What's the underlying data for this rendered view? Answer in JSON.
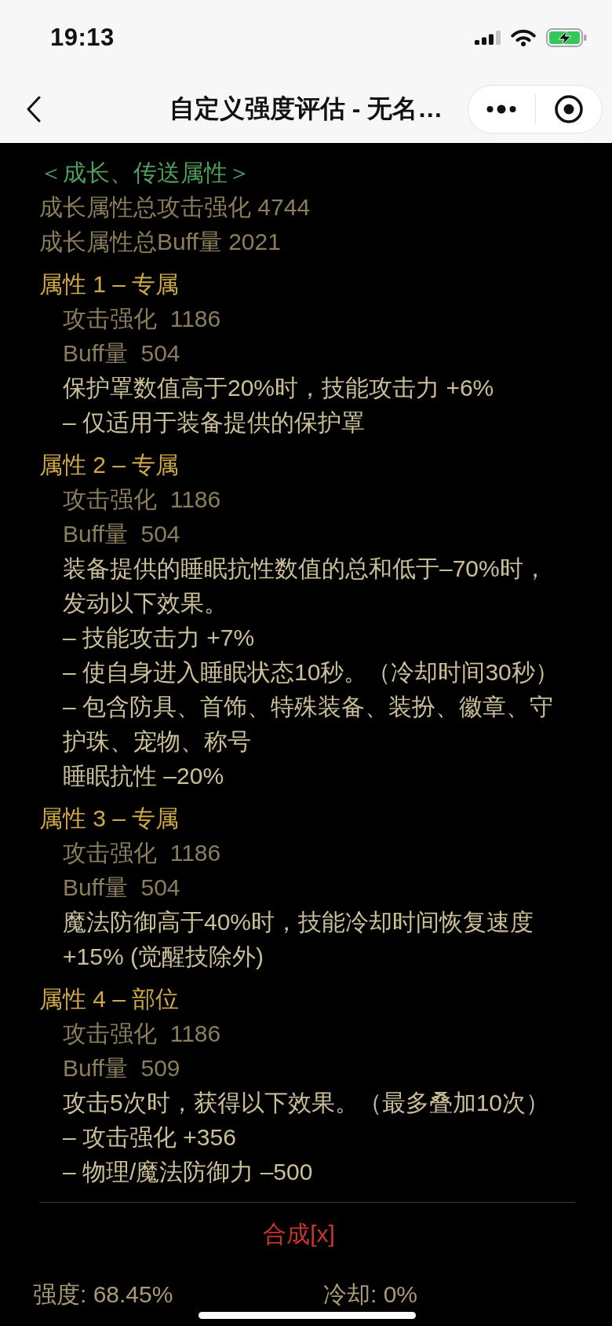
{
  "status_bar": {
    "time": "19:13"
  },
  "nav_bar": {
    "title": "自定义强度评估 - 无名…"
  },
  "growth": {
    "heading": "＜成长、传送属性＞",
    "totals": [
      "成长属性总攻击强化 4744",
      "成长属性总Buff量 2021"
    ]
  },
  "attributes": [
    {
      "title": "属性 1 – 专属",
      "stats": [
        "攻击强化  1186",
        "Buff量  504"
      ],
      "effects": [
        "保护罩数值高于20%时，技能攻击力 +6%",
        "– 仅适用于装备提供的保护罩"
      ]
    },
    {
      "title": "属性 2 – 专属",
      "stats": [
        "攻击强化  1186",
        "Buff量  504"
      ],
      "effects": [
        "装备提供的睡眠抗性数值的总和低于–70%时，发动以下效果。",
        "– 技能攻击力 +7%",
        "– 使自身进入睡眠状态10秒。（冷却时间30秒）",
        "– 包含防具、首饰、特殊装备、装扮、徽章、守护珠、宠物、称号",
        "睡眠抗性 –20%"
      ]
    },
    {
      "title": "属性 3 – 专属",
      "stats": [
        "攻击强化  1186",
        "Buff量  504"
      ],
      "effects": [
        "魔法防御高于40%时，技能冷却时间恢复速度 +15% (觉醒技除外)"
      ]
    },
    {
      "title": "属性 4 – 部位",
      "stats": [
        "攻击强化  1186",
        "Buff量  509"
      ],
      "effects": [
        "攻击5次时，获得以下效果。（最多叠加10次）",
        "– 攻击强化 +356",
        "– 物理/魔法防御力 –500"
      ]
    }
  ],
  "synthesize_link": "合成[x]",
  "footer": {
    "strength": "强度: 68.45%",
    "cooldown": "冷却: 0%"
  }
}
